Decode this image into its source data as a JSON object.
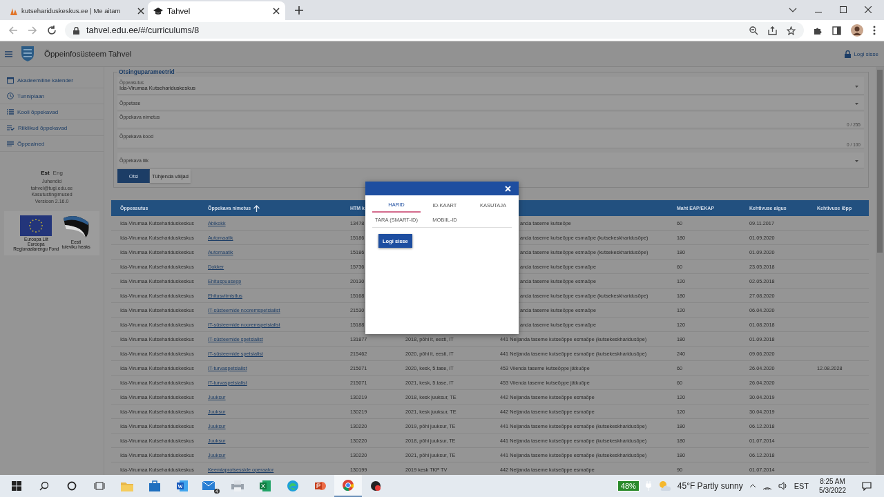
{
  "browser": {
    "tabs": [
      {
        "title": "kutsehariduskeskus.ee | Me aitam",
        "selected": false
      },
      {
        "title": "Tahvel",
        "selected": true
      }
    ],
    "url": "tahvel.edu.ee/#/curriculums/8"
  },
  "app": {
    "title": "Õppeinfosüsteem Tahvel",
    "login": "Logi sisse"
  },
  "sidebar": {
    "items": [
      "Akadeemiline kalender",
      "Tunniplaan",
      "Kooli õppekavad",
      "Riiklikud õppekavad",
      "Õppeained"
    ],
    "languages": [
      {
        "label": "Est",
        "selected": true
      },
      {
        "label": "Eng",
        "selected": false
      }
    ],
    "links": [
      "Juhendid",
      "tahvel@tugi.edu.ee",
      "Kasutustingimused"
    ],
    "version": "Versioon 2.16.0",
    "logos": [
      {
        "caption": [
          "Euroopa Liit",
          "Euroopa",
          "Regionaalarengu Fond"
        ]
      },
      {
        "caption": [
          "Eesti",
          "tuleviku heaks"
        ]
      }
    ]
  },
  "filters": {
    "legend": "Otsinguparameetrid",
    "fields": [
      {
        "kind": "select",
        "label": "Õppeasutus",
        "value": "Ida-Virumaa Kutsehariduskeskus"
      },
      {
        "kind": "select",
        "label": "Õppetase"
      },
      {
        "kind": "text",
        "label": "Õppekava nimetus",
        "counter": "0 / 255"
      },
      {
        "kind": "text",
        "label": "Õppekava kood",
        "counter": "0 / 100"
      },
      {
        "kind": "select",
        "label": "Õppekava liik"
      }
    ],
    "buttons": [
      "Otsi",
      "Tühjenda väljad"
    ]
  },
  "table": {
    "columns": [
      {
        "label": "Õppeasutus",
        "sorted": false
      },
      {
        "label": "Õppekava nimetus",
        "sorted": true,
        "kind": "link"
      },
      {
        "label": "HTM k",
        "sorted": false
      },
      {
        "label": "Maht EAP/EKAP",
        "sorted": false
      },
      {
        "label": "Kehtivuse algus",
        "sorted": false
      },
      {
        "label": "Kehtivuse lõpp",
        "sorted": false
      }
    ],
    "rows": [
      {
        "school": "Ida-Virumaa Kutsehariduskeskus",
        "name": "Abikokk",
        "htm_code": "13478",
        "column_5": "anda taseme kutseõpe",
        "volume": "60",
        "valid_from": "09.11.2017"
      },
      {
        "school": "Ida-Virumaa Kutsehariduskeskus",
        "name": "Automaatik",
        "htm_code": "15186",
        "column_5": "anda taseme kutseõppe esmaõpe (kutsekeskharidusõpe)",
        "volume": "180",
        "valid_from": "01.09.2020"
      },
      {
        "school": "Ida-Virumaa Kutsehariduskeskus",
        "name": "Automaatik",
        "htm_code": "15186",
        "column_5": "anda taseme kutseõppe esmaõpe (kutsekeskharidusõpe)",
        "volume": "180",
        "valid_from": "01.09.2020"
      },
      {
        "school": "Ida-Virumaa Kutsehariduskeskus",
        "name": "Dokker",
        "htm_code": "15736",
        "column_5": "anda taseme kutseõppe esmaõpe",
        "volume": "60",
        "valid_from": "23.05.2018"
      },
      {
        "school": "Ida-Virumaa Kutsehariduskeskus",
        "name": "Ehituspuusepp",
        "htm_code": "20130",
        "column_5": "anda taseme kutseõppe esmaõpe",
        "volume": "120",
        "valid_from": "02.05.2018"
      },
      {
        "school": "Ida-Virumaa Kutsehariduskeskus",
        "name": "Ehitusviimistlus",
        "htm_code": "15168",
        "column_5": "anda taseme kutseõppe esmaõpe (kutsekeskharidusõpe)",
        "volume": "180",
        "valid_from": "27.08.2020"
      },
      {
        "school": "Ida-Virumaa Kutsehariduskeskus",
        "name": "IT-süsteemide nooremspetsialist",
        "htm_code": "21530",
        "column_5": "anda taseme kutseõppe esmaõpe",
        "volume": "120",
        "valid_from": "06.04.2020"
      },
      {
        "school": "Ida-Virumaa Kutsehariduskeskus",
        "name": "IT-süsteemide nooremspetsialist",
        "htm_code": "15188",
        "column_5": "anda taseme kutseõppe esmaõpe",
        "volume": "120",
        "valid_from": "01.08.2018"
      },
      {
        "school": "Ida-Virumaa Kutsehariduskeskus",
        "name": "IT-süsteemide spetsialist",
        "htm_code": "131877",
        "column_4": "2018, põhi it, eesti, IT",
        "column_5": "441 Neljanda taseme kutseõppe esmaõpe (kutsekeskharidusõpe)",
        "volume": "180",
        "valid_from": "01.09.2018"
      },
      {
        "school": "Ida-Virumaa Kutsehariduskeskus",
        "name": "IT-süsteemide spetsialist",
        "htm_code": "215462",
        "column_4": "2020, põhi it, eesti, IT",
        "column_5": "441 Neljanda taseme kutseõppe esmaõpe (kutsekeskharidusõpe)",
        "volume": "240",
        "valid_from": "09.06.2020"
      },
      {
        "school": "Ida-Virumaa Kutsehariduskeskus",
        "name": "IT-turvaspetsialist",
        "htm_code": "215071",
        "column_4": "2020, kesk, 5.tase, IT",
        "column_5": "453 Viienda taseme kutseõppe jätkuõpe",
        "volume": "60",
        "valid_from": "26.04.2020",
        "valid_to": "12.08.2028"
      },
      {
        "school": "Ida-Virumaa Kutsehariduskeskus",
        "name": "IT-turvaspetsialist",
        "htm_code": "215071",
        "column_4": "2021, kesk, 5.tase, IT",
        "column_5": "453 Viienda taseme kutseõppe jätkuõpe",
        "volume": "60",
        "valid_from": "26.04.2020"
      },
      {
        "school": "Ida-Virumaa Kutsehariduskeskus",
        "name": "Juuksur",
        "htm_code": "130219",
        "column_4": "2018, kesk juuksur, TE",
        "column_5": "442 Neljanda taseme kutseõppe esmaõpe",
        "volume": "120",
        "valid_from": "30.04.2019"
      },
      {
        "school": "Ida-Virumaa Kutsehariduskeskus",
        "name": "Juuksur",
        "htm_code": "130219",
        "column_4": "2021, kesk juuksur, TE",
        "column_5": "442 Neljanda taseme kutseõppe esmaõpe",
        "volume": "120",
        "valid_from": "30.04.2019"
      },
      {
        "school": "Ida-Virumaa Kutsehariduskeskus",
        "name": "Juuksur",
        "htm_code": "130220",
        "column_4": "2019, põhi juuksur, TE",
        "column_5": "441 Neljanda taseme kutseõppe esmaõpe (kutsekeskharidusõpe)",
        "volume": "180",
        "valid_from": "06.12.2018"
      },
      {
        "school": "Ida-Virumaa Kutsehariduskeskus",
        "name": "Juuksur",
        "htm_code": "130220",
        "column_4": "2018, põhi juuksur, TE",
        "column_5": "441 Neljanda taseme kutseõppe esmaõpe (kutsekeskharidusõpe)",
        "volume": "180",
        "valid_from": "01.07.2014"
      },
      {
        "school": "Ida-Virumaa Kutsehariduskeskus",
        "name": "Juuksur",
        "htm_code": "130220",
        "column_4": "2021, põhi juuksur, TE",
        "column_5": "441 Neljanda taseme kutseõppe esmaõpe (kutsekeskharidusõpe)",
        "volume": "180",
        "valid_from": "06.12.2018"
      },
      {
        "school": "Ida-Virumaa Kutsehariduskeskus",
        "name": "Keemiaprotsesside operaator",
        "htm_code": "130199",
        "column_4": "2019 kesk TKP TV",
        "column_5": "442 Neljanda taseme kutseõppe esmaõpe",
        "volume": "90",
        "valid_from": "01.07.2014"
      }
    ]
  },
  "modal": {
    "tabs": [
      {
        "label": "HARID",
        "selected": true
      },
      {
        "label": "ID-KAART",
        "selected": false
      },
      {
        "label": "KASUTAJA",
        "selected": false
      },
      {
        "label": "TARA (SMART-ID)",
        "selected": false
      },
      {
        "label": "MOBIIL-ID",
        "selected": false
      }
    ],
    "button": "Logi sisse"
  },
  "taskbar": {
    "apps": [
      {
        "selected": false
      },
      {
        "selected": false
      },
      {
        "selected": false
      },
      {
        "selected": false
      },
      {
        "selected": false
      },
      {
        "selected": false
      },
      {
        "selected": false
      },
      {
        "selected": false,
        "badge": "4"
      },
      {
        "selected": false
      },
      {
        "selected": false
      },
      {
        "selected": false
      },
      {
        "selected": false
      },
      {
        "selected": true
      },
      {
        "selected": false
      }
    ],
    "battery": "48%",
    "weather": "45°F Partly sunny",
    "language": "EST",
    "time": "8:25 AM",
    "date": "5/3/2022"
  }
}
